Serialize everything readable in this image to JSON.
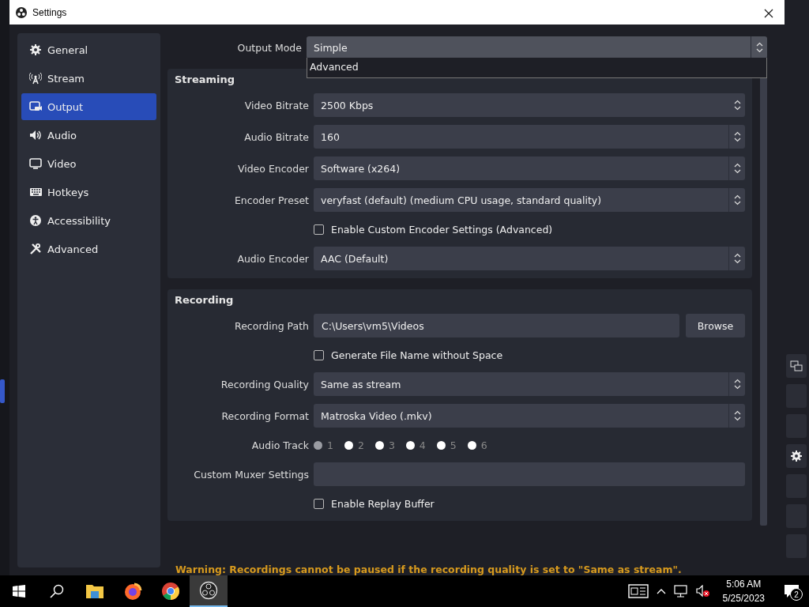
{
  "window": {
    "title": "Settings"
  },
  "sidebar": {
    "items": [
      {
        "label": "General",
        "selected": false
      },
      {
        "label": "Stream",
        "selected": false
      },
      {
        "label": "Output",
        "selected": true
      },
      {
        "label": "Audio",
        "selected": false
      },
      {
        "label": "Video",
        "selected": false
      },
      {
        "label": "Hotkeys",
        "selected": false
      },
      {
        "label": "Accessibility",
        "selected": false
      },
      {
        "label": "Advanced",
        "selected": false
      }
    ]
  },
  "output_mode": {
    "label": "Output Mode",
    "value": "Simple",
    "expanded": true,
    "options": [
      "Advanced"
    ]
  },
  "groups": [
    {
      "title": "Streaming",
      "rows": [
        {
          "kind": "spin",
          "label": "Video Bitrate",
          "value": "2500 Kbps"
        },
        {
          "kind": "select",
          "label": "Audio Bitrate",
          "value": "160"
        },
        {
          "kind": "select",
          "label": "Video Encoder",
          "value": "Software (x264)"
        },
        {
          "kind": "select",
          "label": "Encoder Preset",
          "value": "veryfast (default) (medium CPU usage, standard quality)"
        },
        {
          "kind": "checkbox",
          "label": "Enable Custom Encoder Settings (Advanced)",
          "checked": false
        },
        {
          "kind": "select",
          "label": "Audio Encoder",
          "value": "AAC (Default)"
        }
      ]
    },
    {
      "title": "Recording",
      "rows": [
        {
          "kind": "path",
          "label": "Recording Path",
          "value": "C:\\Users\\vm5\\Videos",
          "button": "Browse"
        },
        {
          "kind": "checkbox",
          "label": "Generate File Name without Space",
          "checked": false
        },
        {
          "kind": "select",
          "label": "Recording Quality",
          "value": "Same as stream"
        },
        {
          "kind": "select",
          "label": "Recording Format",
          "value": "Matroska Video (.mkv)"
        },
        {
          "kind": "radios",
          "label": "Audio Track",
          "options": [
            {
              "label": "1",
              "selected": true
            },
            {
              "label": "2",
              "selected": false
            },
            {
              "label": "3",
              "selected": false
            },
            {
              "label": "4",
              "selected": false
            },
            {
              "label": "5",
              "selected": false
            },
            {
              "label": "6",
              "selected": false
            }
          ]
        },
        {
          "kind": "text",
          "label": "Custom Muxer Settings"
        },
        {
          "kind": "checkbox",
          "label": "Enable Replay Buffer",
          "checked": false
        }
      ]
    }
  ],
  "warning": "Warning: Recordings cannot be paused if the recording quality is set to \"Same as stream\".",
  "taskbar": {
    "apps": [
      {
        "kind": "files",
        "active": false
      },
      {
        "kind": "firefox",
        "active": false
      },
      {
        "kind": "chrome",
        "active": false
      },
      {
        "kind": "obs",
        "active": true
      }
    ],
    "time": "5:06 AM",
    "date": "5/25/2023",
    "notifications": "2"
  }
}
